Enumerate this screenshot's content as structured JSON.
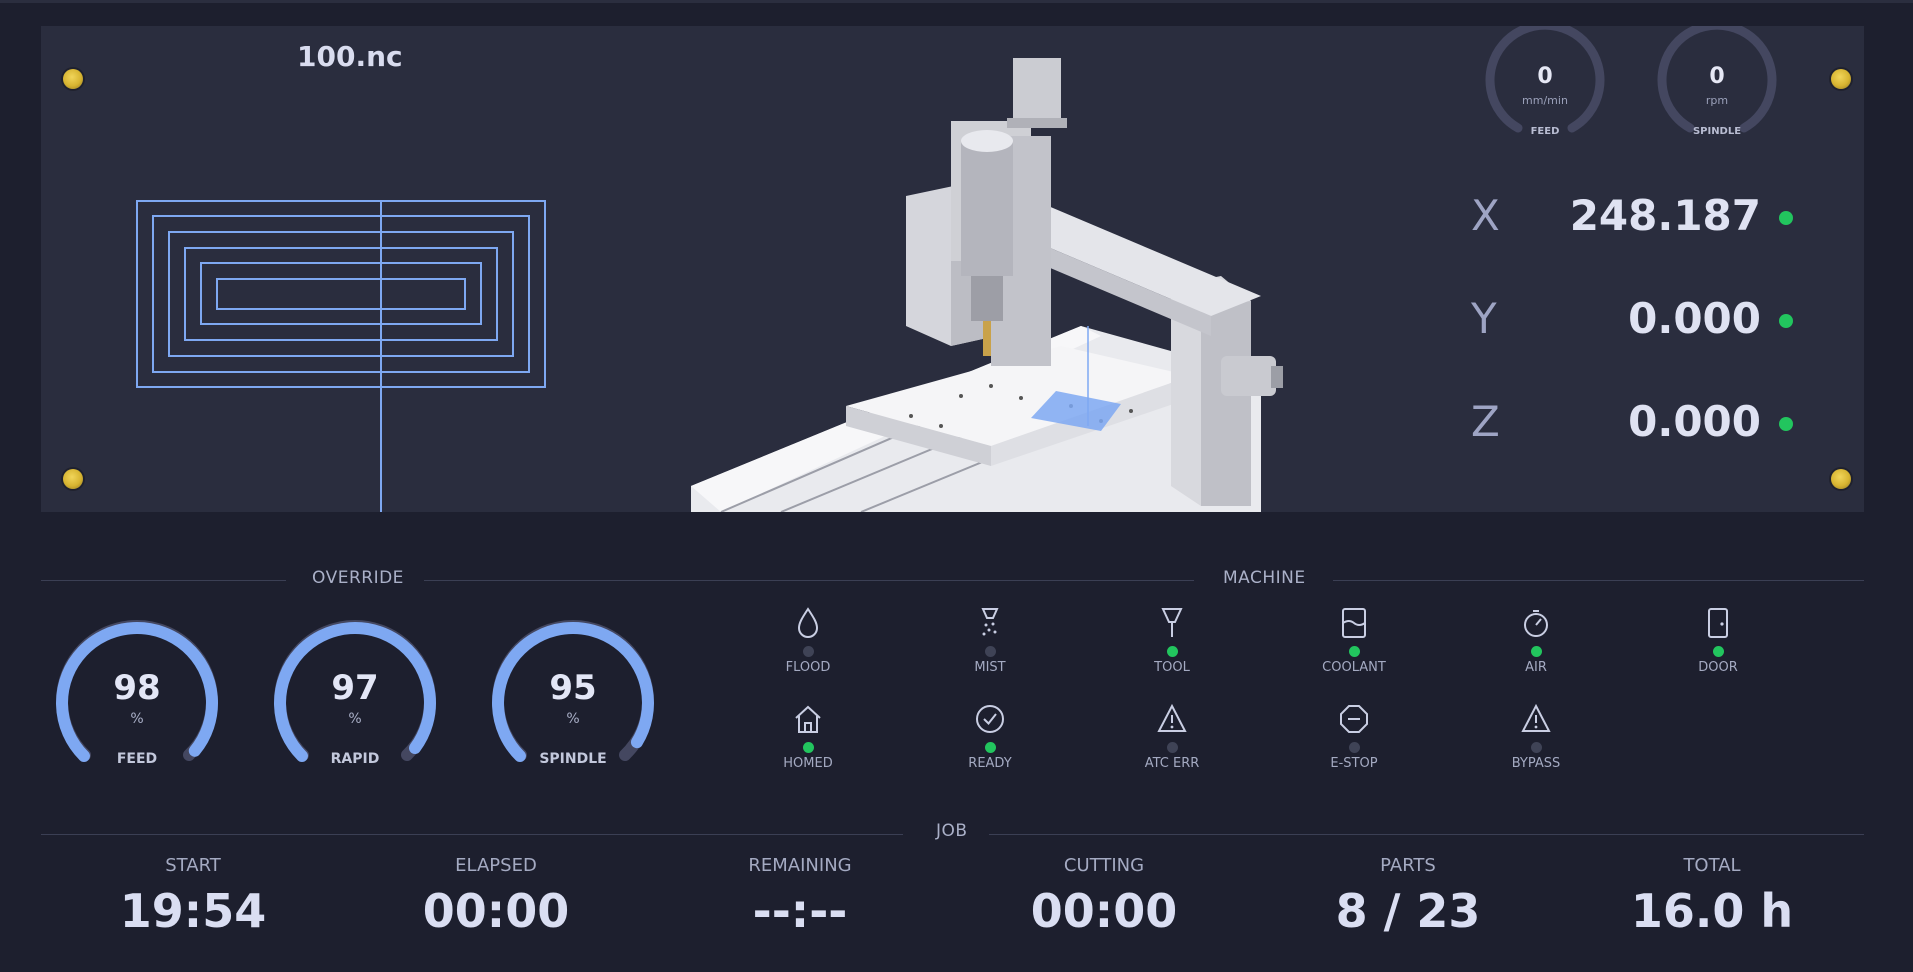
{
  "viewer": {
    "filename": "100.nc",
    "gauges": [
      {
        "value": "0",
        "unit": "mm/min",
        "label": "FEED"
      },
      {
        "value": "0",
        "unit": "rpm",
        "label": "SPINDLE"
      }
    ],
    "axes": [
      {
        "name": "X",
        "value": "248.187",
        "status_color": "#22c55e"
      },
      {
        "name": "Y",
        "value": "0.000",
        "status_color": "#22c55e"
      },
      {
        "name": "Z",
        "value": "0.000",
        "status_color": "#22c55e"
      }
    ]
  },
  "override": {
    "title": "OVERRIDE",
    "gauges": [
      {
        "value": "98",
        "unit": "%",
        "label": "FEED",
        "percent": 98
      },
      {
        "value": "97",
        "unit": "%",
        "label": "RAPID",
        "percent": 97
      },
      {
        "value": "95",
        "unit": "%",
        "label": "SPINDLE",
        "percent": 95
      }
    ]
  },
  "machine": {
    "title": "MACHINE",
    "indicators": [
      {
        "label": "FLOOD",
        "icon": "drop-icon",
        "on": false
      },
      {
        "label": "MIST",
        "icon": "mist-icon",
        "on": false
      },
      {
        "label": "TOOL",
        "icon": "tool-icon",
        "on": true
      },
      {
        "label": "COOLANT",
        "icon": "coolant-tank-icon",
        "on": true
      },
      {
        "label": "AIR",
        "icon": "gauge-icon",
        "on": true
      },
      {
        "label": "DOOR",
        "icon": "door-icon",
        "on": true
      },
      {
        "label": "HOMED",
        "icon": "home-icon",
        "on": true
      },
      {
        "label": "READY",
        "icon": "check-circle-icon",
        "on": true
      },
      {
        "label": "ATC ERR",
        "icon": "warning-icon",
        "on": false
      },
      {
        "label": "E-STOP",
        "icon": "stop-icon",
        "on": false
      },
      {
        "label": "BYPASS",
        "icon": "warning-icon",
        "on": false
      }
    ]
  },
  "job": {
    "title": "JOB",
    "stats": [
      {
        "label": "START",
        "value": "19:54"
      },
      {
        "label": "ELAPSED",
        "value": "00:00"
      },
      {
        "label": "REMAINING",
        "value": "--:--"
      },
      {
        "label": "CUTTING",
        "value": "00:00"
      },
      {
        "label": "PARTS",
        "value": "8 / 23"
      },
      {
        "label": "TOTAL",
        "value": "16.0 h"
      }
    ]
  },
  "colors": {
    "accent": "#7ea8f2",
    "track": "#444760",
    "led_on": "#22c55e",
    "led_off": "#3f4356",
    "panel": "#2a2d3e",
    "background": "#1d1f2e",
    "toolpath": "#7ea8f2"
  }
}
